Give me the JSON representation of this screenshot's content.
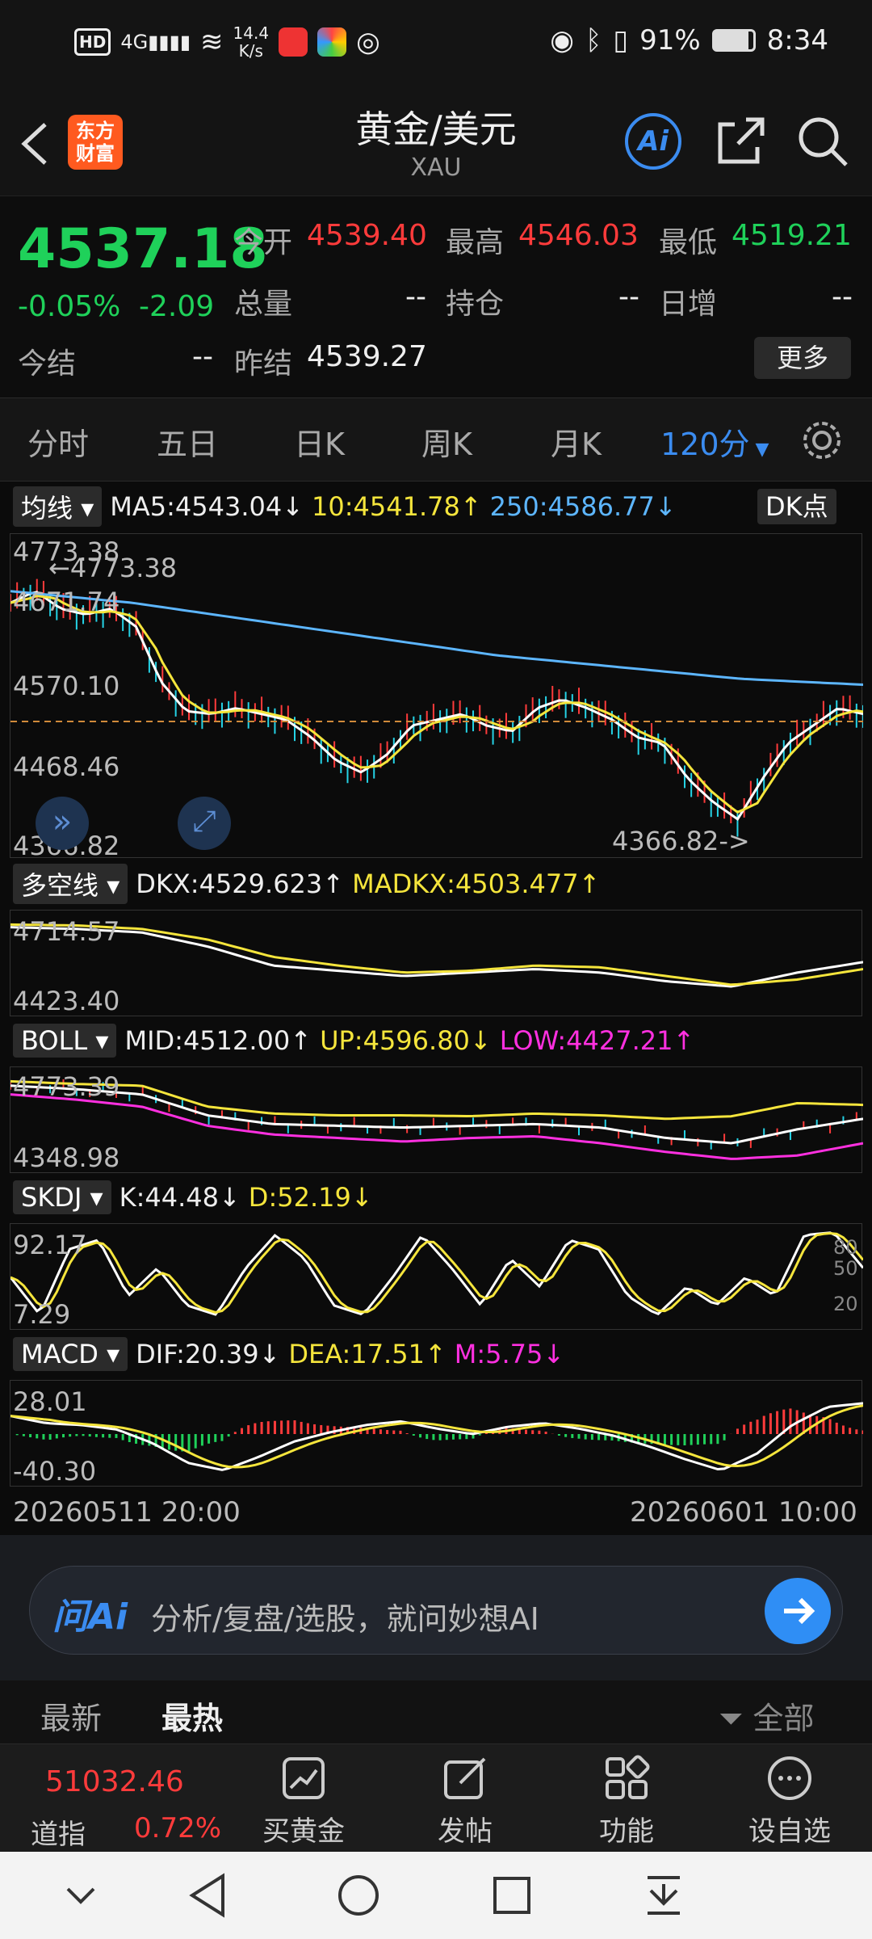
{
  "status_bar": {
    "speed_top": "14.4",
    "speed_unit": "K/s",
    "battery": "91%",
    "time": "8:34",
    "hd": "HD",
    "net": "4G"
  },
  "header": {
    "title": "黄金/美元",
    "subtitle": "XAU",
    "logo_line1": "东方",
    "logo_line2": "财富",
    "ai_label": "Ai"
  },
  "quote": {
    "price": "4537.18",
    "change_pct": "-0.05%",
    "change": "-2.09",
    "open_label": "今开",
    "open": "4539.40",
    "high_label": "最高",
    "high": "4546.03",
    "low_label": "最低",
    "low": "4519.21",
    "volume_label": "总量",
    "volume": "--",
    "position_label": "持仓",
    "position": "--",
    "daily_inc_label": "日增",
    "daily_inc": "--",
    "settle_label": "今结",
    "settle": "--",
    "prev_settle_label": "昨结",
    "prev_settle": "4539.27",
    "more_label": "更多"
  },
  "tabs": [
    "分时",
    "五日",
    "日K",
    "周K",
    "月K",
    "120分"
  ],
  "active_tab": "120分",
  "indicators": {
    "ma": {
      "name": "均线",
      "ma5": "MA5:4543.04",
      "ma5_arrow": "↓",
      "ma10": "10:4541.78",
      "ma10_arrow": "↑",
      "ma250": "250:4586.77",
      "ma250_arrow": "↓",
      "dk_label": "DK点"
    },
    "dkx": {
      "name": "多空线",
      "dkx": "DKX:4529.623",
      "dkx_arrow": "↑",
      "madkx": "MADKX:4503.477",
      "madkx_arrow": "↑"
    },
    "boll": {
      "name": "BOLL",
      "mid": "MID:4512.00",
      "mid_arrow": "↑",
      "up": "UP:4596.80",
      "up_arrow": "↓",
      "low": "LOW:4427.21",
      "low_arrow": "↑"
    },
    "skdj": {
      "name": "SKDJ",
      "k": "K:44.48",
      "k_arrow": "↓",
      "d": "D:52.19",
      "d_arrow": "↓"
    },
    "macd": {
      "name": "MACD",
      "dif": "DIF:20.39",
      "dif_arrow": "↓",
      "dea": "DEA:17.51",
      "dea_arrow": "↑",
      "m": "M:5.75",
      "m_arrow": "↓"
    }
  },
  "axes": {
    "main": [
      "4773.38",
      "4671.74",
      "4570.10",
      "4468.46",
      "4366.82"
    ],
    "main_high_mark": "←4773.38",
    "main_low_mark": "4366.82->",
    "dkx": [
      "4714.57",
      "4423.40"
    ],
    "boll": [
      "4773.39",
      "4348.98"
    ],
    "skdj": [
      "92.17",
      "7.29"
    ],
    "skdj_right": [
      "80",
      "50",
      "20"
    ],
    "macd": [
      "28.01",
      "-40.30"
    ],
    "time_start": "20260511 20:00",
    "time_end": "20260601 10:00"
  },
  "ai_bar": {
    "logo": "问Ai",
    "placeholder": "分析/复盘/选股，就问妙想AI"
  },
  "news_tabs": {
    "latest": "最新",
    "hot": "最热",
    "filter": "全部"
  },
  "bottom_nav": {
    "index_value": "51032.46",
    "index_name": "道指",
    "index_change": "0.72%",
    "buy_gold": "买黄金",
    "post": "发帖",
    "features": "功能",
    "watchlist": "设自选"
  },
  "colors": {
    "up": "#ff3b3b",
    "down": "#1fd15a",
    "accent": "#3b8cf0",
    "ma5": "#ffffff",
    "ma10": "#f5e53c",
    "ma250": "#5db6ff",
    "low": "#ff30e0"
  }
}
